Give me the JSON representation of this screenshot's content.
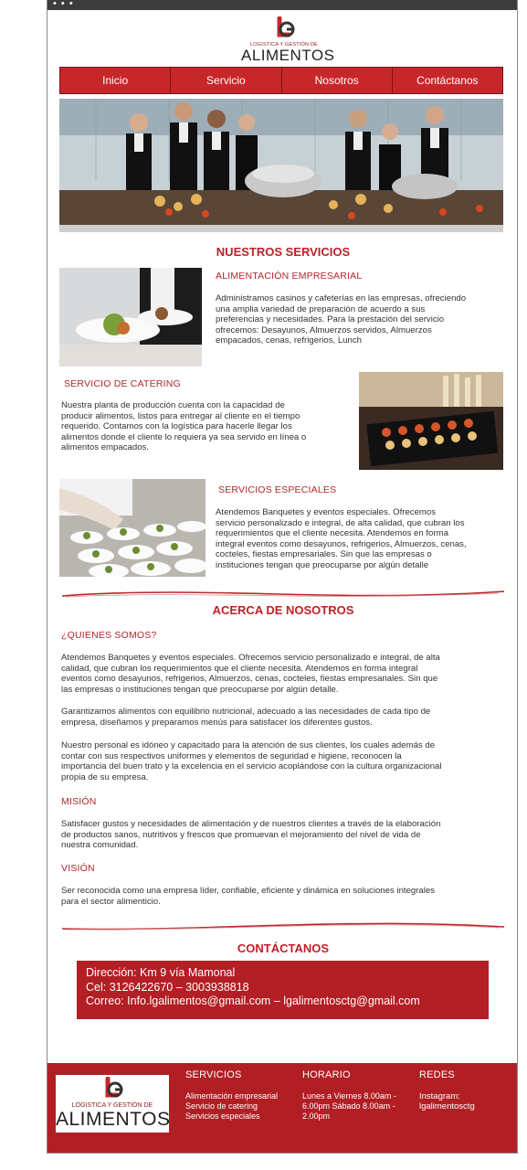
{
  "window": {
    "dots": "• • •"
  },
  "logo": {
    "small_text": "LOGISTICA Y GESTIÓN DE",
    "big_text": "ALIMENTOS"
  },
  "nav": {
    "items": [
      "Inicio",
      "Servicio",
      "Nosotros",
      "Contáctanos"
    ]
  },
  "services": {
    "title": "NUESTROS SERVICIOS",
    "items": [
      {
        "heading": "ALIMENTACIÓN EMPRESARIAL",
        "lines": [
          "Administramos casinos y cafeterías en las empresas, ofreciendo",
          "una amplia variedad de preparación de acuerdo a sus",
          "preferencias y necesidades. Para la prestación del servicio",
          "ofrecemos: Desayunos, Almuerzos servidos, Almuerzos",
          "empacados, cenas, refrigerios, Lunch"
        ]
      },
      {
        "heading": "SERVICIO DE CATERING",
        "lines": [
          "Nuestra planta de producción cuenta con la capacidad de",
          "producir alimentos, listos para entregar al cliente en el tiempo",
          "requerido. Contamos con la logística para hacerle llegar los",
          "alimentos donde el cliente lo requiera ya sea servido en línea o",
          "alimentos empacados."
        ]
      },
      {
        "heading": "SERVICIOS  ESPECIALES",
        "lines": [
          "Atendemos Banquetes y eventos especiales. Ofrecemos",
          "servicio personalizado e integral, de alta calidad, que cubran los",
          "requerimientos que el cliente necesita. Atendemos en forma",
          "integral eventos como desayunos, refrigerios, Almuerzos, cenas,",
          "cocteles, fiestas empresariales. Sin que las empresas o",
          "instituciones tengan que preocuparse por algún detalle"
        ]
      }
    ]
  },
  "about": {
    "title": "ACERCA DE NOSOTROS",
    "who_heading": "¿QUIENES SOMOS?",
    "who_p1": [
      "Atendemos Banquetes y eventos especiales. Ofrecemos servicio personalizado e integral, de alta",
      "calidad, que cubran los requerimientos que el cliente necesita. Atendemos en forma integral",
      "eventos como desayunos, refrigerios, Almuerzos, cenas, cocteles, fiestas empresariales. Sin que",
      "las empresas o instituciones tengan que preocuparse por algún detalle."
    ],
    "who_p2": [
      "Garantizamos alimentos con equilibrio nutricional, adecuado a las necesidades de cada tipo de",
      "empresa, diseñamos y preparamos menús para satisfacer los diferentes gustos."
    ],
    "who_p3": [
      "Nuestro personal es idóneo y capacitado para la atención de sus clientes, los cuales además de",
      "contar con sus respectivos uniformes y elementos de seguridad e higiene, reconocen la",
      "importancia del buen trato y la excelencia en el servicio acoplándose con la cultura organizacional",
      "propia de su empresa."
    ],
    "mission_heading": "MISIÓN",
    "mission": [
      "Satisfacer gustos y necesidades de alimentación y de nuestros clientes a través de la elaboración",
      "de productos sanos, nutritivos y frescos que promuevan el mejoramiento del nivel de vida de",
      "nuestra comunidad."
    ],
    "vision_heading": "VISIÓN",
    "vision": [
      "Ser reconocida como una empresa líder, confiable, eficiente y dinámica en soluciones integrales",
      "para el sector alimenticio."
    ]
  },
  "contact": {
    "title": "CONTÁCTANOS",
    "address": "Dirección: Km 9 vía Mamonal",
    "phone": "Cel: 3126422670 – 3003938818",
    "email": "Correo: Info.lgalimentos@gmail.com – lgalimentosctg@gmail.com"
  },
  "footer": {
    "services_title": "SERVICIOS",
    "services": [
      "Alimentación empresarial",
      "Servicio de catering",
      "Servicios especiales"
    ],
    "hours_title": "HORARIO",
    "hours": [
      "Lunes a Viernes 8.00am -",
      "6.00pm Sábado 8.00am -",
      "2.00pm"
    ],
    "social_title": "REDES",
    "social": [
      "Instagram:",
      "lgalimentosctg"
    ]
  },
  "colors": {
    "brand_red": "#c8272a",
    "footer_red": "#b11f24",
    "heading_red": "#c01f26"
  }
}
